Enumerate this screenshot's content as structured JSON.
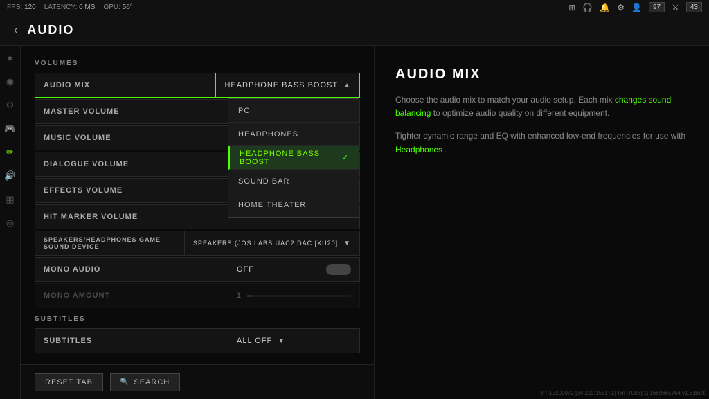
{
  "topbar": {
    "fps_label": "FPS:",
    "fps_value": "120",
    "latency_label": "LATENCY:",
    "latency_value": "0 MS",
    "gpu_label": "GPU:",
    "gpu_value": "56°",
    "level1_value": "97",
    "level2_value": "43"
  },
  "header": {
    "back_label": "‹",
    "title": "AUDIO"
  },
  "left_panel": {
    "volumes_label": "VOLUMES",
    "settings": [
      {
        "id": "audio-mix",
        "label": "AUDIO MIX",
        "value": "HEADPHONE BASS BOOST",
        "has_dropdown": true,
        "has_star": false
      },
      {
        "id": "master-volume",
        "label": "MASTER VOLUME",
        "value": "",
        "has_star": true
      },
      {
        "id": "music-volume",
        "label": "MUSIC VOLUME",
        "value": "",
        "has_star": false
      },
      {
        "id": "dialogue-volume",
        "label": "DIALOGUE VOLUME",
        "value": "",
        "has_star": false
      },
      {
        "id": "effects-volume",
        "label": "EFFECTS VOLUME",
        "value": "",
        "has_star": false
      },
      {
        "id": "hit-marker-volume",
        "label": "HIT MARKER VOLUME",
        "value": "",
        "has_star": false
      },
      {
        "id": "sound-device",
        "label": "SPEAKERS/HEADPHONES GAME SOUND DEVICE",
        "value": "SPEAKERS (JOS LABS UAC2 DAC [XU20]",
        "has_dropdown": true
      },
      {
        "id": "mono-audio",
        "label": "MONO AUDIO",
        "value": "OFF",
        "has_toggle": true
      },
      {
        "id": "mono-amount",
        "label": "MONO AMOUNT",
        "value": "1",
        "has_slider": true,
        "disabled": true
      }
    ],
    "subtitles_label": "SUBTITLES",
    "subtitles_settings": [
      {
        "id": "subtitles",
        "label": "SUBTITLES",
        "value": "ALL OFF",
        "has_dropdown": true
      }
    ],
    "dropdown_items": [
      {
        "id": "pc",
        "label": "PC",
        "selected": false
      },
      {
        "id": "headphones",
        "label": "HEADPHONES",
        "selected": false
      },
      {
        "id": "headphone-bass-boost",
        "label": "HEADPHONE BASS BOOST",
        "selected": true
      },
      {
        "id": "sound-bar",
        "label": "SOUND BAR",
        "selected": false
      },
      {
        "id": "home-theater",
        "label": "HOME THEATER",
        "selected": false
      }
    ]
  },
  "right_panel": {
    "title": "AUDIO MIX",
    "description1": "Choose the audio mix to match your audio setup. Each mix",
    "description1_link": "changes sound balancing",
    "description1_end": "to optimize audio quality on different equipment.",
    "description2_start": "Tighter dynamic range and EQ with enhanced low-end frequencies for use with",
    "description2_link": "Headphones",
    "description2_end": "."
  },
  "bottom_bar": {
    "reset_label": "RESET TAB",
    "search_label": "SEARCH"
  },
  "build_info": "9.7.13200072 [34.222:1561+1] Tm [7003][1] 1669665764 v1.6.bnet",
  "sidebar_icons": [
    "★",
    "◎",
    "⚙",
    "🎮",
    "✏",
    "🔊",
    "▦",
    "◎"
  ]
}
